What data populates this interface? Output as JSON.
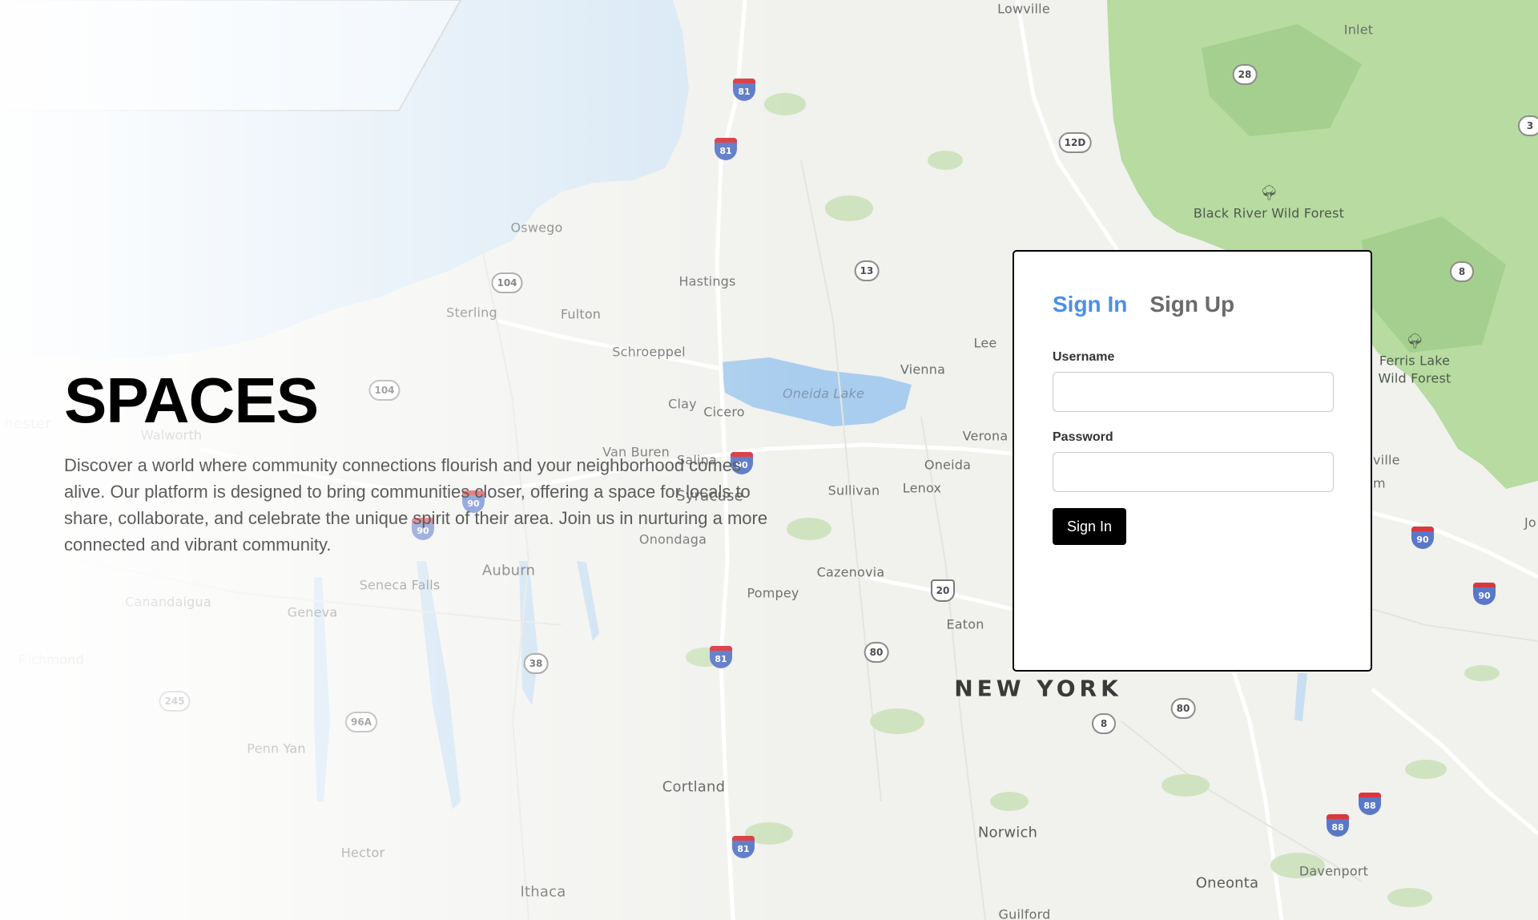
{
  "hero": {
    "title": "SPACES",
    "description": "Discover a world where community connections flourish and your neighborhood comes alive. Our platform is designed to bring communities closer, offering a space for locals to share, collaborate, and celebrate the unique spirit of their area. Join us in nurturing a more connected and vibrant community."
  },
  "auth": {
    "tabs": [
      {
        "label": "Sign In",
        "active": true
      },
      {
        "label": "Sign Up",
        "active": false
      }
    ],
    "username_label": "Username",
    "password_label": "Password",
    "submit_label": "Sign In",
    "colors": {
      "active_tab": "#4c8fe8",
      "inactive_tab": "#6b6b6b",
      "button_bg": "#000000",
      "card_border": "#000000"
    }
  },
  "map": {
    "labels": {
      "lowville": "Lowville",
      "inlet": "Inlet",
      "black_river": "Black River Wild Forest",
      "oswego": "Oswego",
      "hastings": "Hastings",
      "sterling": "Sterling",
      "fulton": "Fulton",
      "schroeppel": "Schroeppel",
      "lee": "Lee",
      "vienna": "Vienna",
      "ferris_lake": "Ferris Lake",
      "wild_forest": "Wild Forest",
      "clay": "Clay",
      "cicero": "Cicero",
      "oneida_lake": "Oneida Lake",
      "walworth": "Walworth",
      "verona": "Verona",
      "van_buren": "Van Buren",
      "salina": "Salina",
      "oneida": "Oneida",
      "sullivan": "Sullivan",
      "lenox": "Lenox",
      "syracuse": "Syracuse",
      "onondaga": "Onondaga",
      "auburn": "Auburn",
      "seneca_falls": "Seneca Falls",
      "cazenovia": "Cazenovia",
      "pompey": "Pompey",
      "canandaigua": "Canandaigua",
      "geneva": "Geneva",
      "eaton": "Eaton",
      "richmond": "Richmond",
      "new_york": "NEW YORK",
      "penn_yan": "Penn Yan",
      "cortland": "Cortland",
      "norwich": "Norwich",
      "hector": "Hector",
      "davenport": "Davenport",
      "oneonta": "Oneonta",
      "ithaca": "Ithaca",
      "guilford": "Guilford",
      "manchester_partial": "hester",
      "ville_partial": "ville",
      "m_partial": "m",
      "jo_partial": "Jo"
    },
    "shields": {
      "r28": "28",
      "r12d": "12D",
      "r13": "13",
      "r104a": "104",
      "r104b": "104",
      "r8": "8",
      "r3": "3",
      "r20": "20",
      "r80a": "80",
      "r80b": "80",
      "r8b": "8",
      "r38": "38",
      "r245": "245",
      "r96a": "96A",
      "i81a": "81",
      "i81b": "81",
      "i81c": "81",
      "i81d": "81",
      "i90a": "90",
      "i90b": "90",
      "i90c": "90",
      "i90d": "90",
      "i90e": "90",
      "i88a": "88",
      "i88b": "88"
    },
    "colors": {
      "lake": "#d9e8f5",
      "forest": "#b8dba0",
      "forest_dark": "#a6d08f",
      "inland_lake": "#a9cdee",
      "road": "#ffffff",
      "land": "#f1f1ee"
    }
  }
}
